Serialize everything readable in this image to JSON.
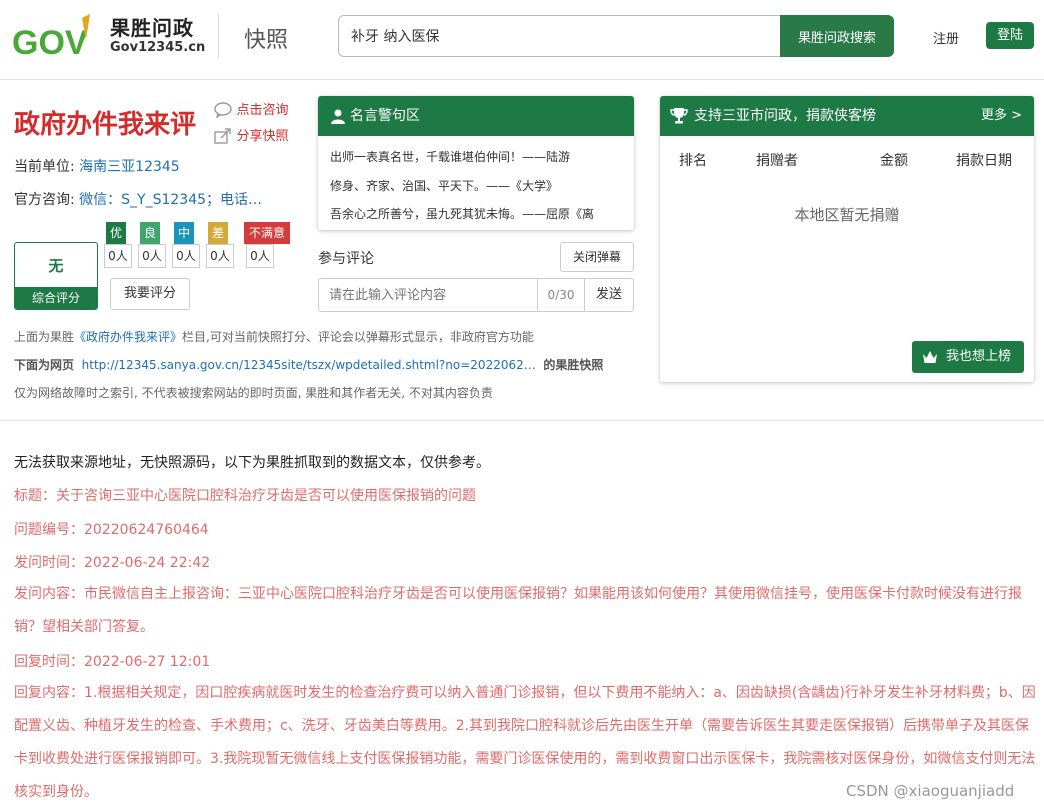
{
  "header": {
    "logo_title": "果胜问政",
    "logo_sub": "Gov12345.cn",
    "logo_text": "GOV",
    "page_label": "快照",
    "search_value": "补牙 纳入医保",
    "search_button": "果胜问政搜索",
    "register": "注册",
    "login": "登陆"
  },
  "evaluation": {
    "title": "政府办件我来评",
    "click_consult": "点击咨询",
    "share_snapshot": "分享快照",
    "unit_label": "当前单位:",
    "unit_value": "海南三亚12345",
    "consult_label": "官方咨询:",
    "consult_value": "微信：S_Y_S12345；电话…",
    "overall_value": "无",
    "overall_label": "综合评分",
    "ratings": [
      {
        "label": "优",
        "count": "0人",
        "color": "#1e7a45"
      },
      {
        "label": "良",
        "count": "0人",
        "color": "#3fa66e"
      },
      {
        "label": "中",
        "count": "0人",
        "color": "#1a94b8"
      },
      {
        "label": "差",
        "count": "0人",
        "color": "#d4a935"
      },
      {
        "label": "不满意",
        "count": "0人",
        "color": "#d43c3c"
      }
    ],
    "rate_button": "我要评分"
  },
  "notice": {
    "line1_prefix": "上面为果胜",
    "line1_link": "《政府办件我来评》",
    "line1_suffix": "栏目,可对当前快照打分、评论会以弹幕形式显示，非政府官方功能",
    "line2_label": "下面为网页",
    "line2_url": "http://12345.sanya.gov.cn/12345site/tszx/wpdetailed.shtml?no=2022062…",
    "line2_suffix": "的果胜快照",
    "line3": "仅为网络故障时之索引, 不代表被搜索网站的即时页面, 果胜和其作者无关, 不对其内容负责"
  },
  "quotes": {
    "title": "名言警句区",
    "lines": [
      "出师一表真名世，千载谁堪伯仲间！——陆游",
      "修身、齐家、治国、平天下。——《大学》",
      "吾余心之所善兮，虽九死其犹未悔。——屈原《离"
    ]
  },
  "comment": {
    "title": "参与评论",
    "close_barrage": "关闭弹幕",
    "placeholder": "请在此输入评论内容",
    "count": "0/30",
    "send": "发送"
  },
  "donation": {
    "title": "支持三亚市问政，捐款侠客榜",
    "more": "更多 >",
    "columns": [
      "排名",
      "捐赠者",
      "金额",
      "捐款日期"
    ],
    "empty": "本地区暂无捐赠",
    "join_button": "我也想上榜"
  },
  "content": {
    "intro": "无法获取来源地址，无快照源码，以下为果胜抓取到的数据文本，仅供参考。",
    "title_line": "标题：关于咨询三亚中心医院口腔科治疗牙齿是否可以使用医保报销的问题",
    "number_line": "问题编号：20220624760464",
    "ask_time_line": "发问时间：2022-06-24 22:42",
    "ask_content": "发问内容：市民微信自主上报咨询：三亚中心医院口腔科治疗牙齿是否可以使用医保报销？如果能用该如何使用？其使用微信挂号，使用医保卡付款时候没有进行报销？望相关部门答复。",
    "reply_time_line": "回复时间：2022-06-27 12:01",
    "reply_content": "回复内容：1.根据相关规定，因口腔疾病就医时发生的检查治疗费可以纳入普通门诊报销，但以下费用不能纳入：a、因齿缺损(含龋齿)行补牙发生补牙材料费；b、因配置义齿、种植牙发生的检查、手术费用；c、洗牙、牙齿美白等费用。2.其到我院口腔科就诊后先由医生开单（需要告诉医生其要走医保报销）后携带单子及其医保卡到收费处进行医保报销即可。3.我院现暂无微信线上支付医保报销功能，需要门诊医保使用的，需到收费窗口出示医保卡，我院需核对医保身份，如微信支付则无法核实到身份。"
  },
  "watermark": "CSDN @xiaoguanjiadd"
}
